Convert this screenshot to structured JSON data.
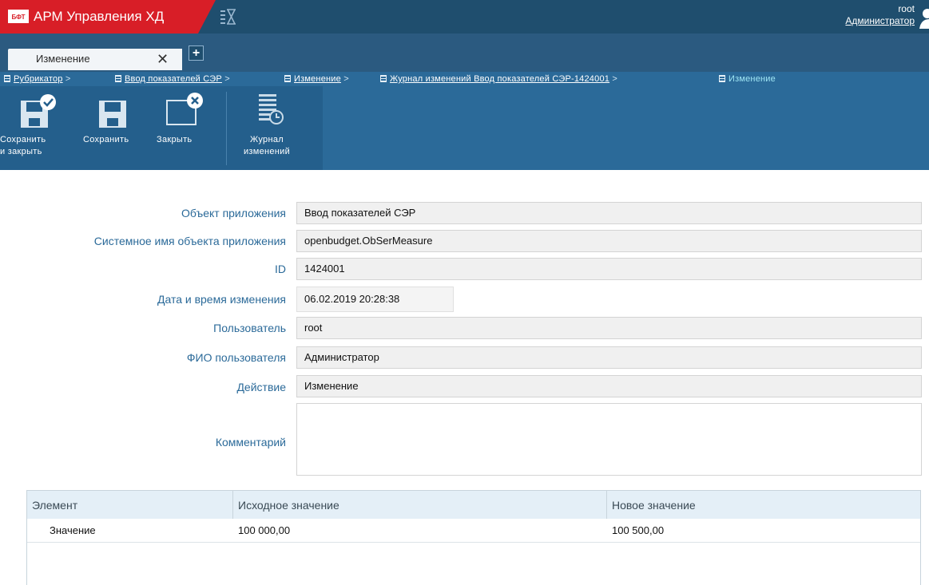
{
  "app": {
    "logo_text": "БФТ",
    "title": "АРМ Управления ХД",
    "user_login": "root",
    "user_role": "Администратор"
  },
  "tabs": [
    {
      "label": "Изменение",
      "active": true
    }
  ],
  "breadcrumbs": [
    {
      "label": "Рубрикатор",
      "link": true
    },
    {
      "label": "Ввод показателей СЭР",
      "link": true
    },
    {
      "label": "Изменение",
      "link": true
    },
    {
      "label": "Журнал изменений Ввод показателей СЭР-1424001",
      "link": true
    },
    {
      "label": "Изменение",
      "link": false
    }
  ],
  "breadcrumb_separator": ">",
  "toolbar": {
    "save_close_line1": "Сохранить",
    "save_close_line2": "и закрыть",
    "save": "Сохранить",
    "close": "Закрыть",
    "journal_line1": "Журнал",
    "journal_line2": "изменений"
  },
  "form": {
    "app_object": {
      "label": "Объект приложения",
      "value": "Ввод показателей СЭР"
    },
    "system_name": {
      "label": "Системное имя объекта приложения",
      "value": "openbudget.ObSerMeasure"
    },
    "id": {
      "label": "ID",
      "value": "1424001"
    },
    "changed_at": {
      "label": "Дата и время изменения",
      "value": "06.02.2019 20:28:38"
    },
    "user": {
      "label": "Пользователь",
      "value": "root"
    },
    "user_fullname": {
      "label": "ФИО пользователя",
      "value": "Администратор"
    },
    "action": {
      "label": "Действие",
      "value": "Изменение"
    },
    "comment": {
      "label": "Комментарий",
      "value": ""
    }
  },
  "grid": {
    "columns": [
      "Элемент",
      "Исходное значение",
      "Новое значение"
    ],
    "rows": [
      {
        "element": "Значение",
        "old_value": "100 000,00",
        "new_value": "100 500,00"
      }
    ]
  },
  "colors": {
    "brand_red": "#d81e27",
    "header_dark": "#1f4e6e",
    "toolbar_blue": "#2b6a99",
    "label_blue": "#2b6a99"
  }
}
